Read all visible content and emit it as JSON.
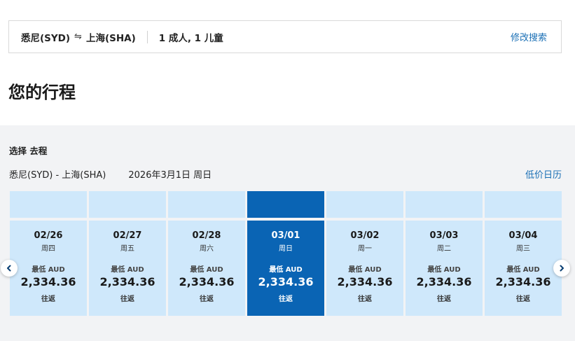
{
  "search": {
    "origin": "悉尼(SYD)",
    "destination": "上海(SHA)",
    "passengers": "1 成人, 1 儿童",
    "modify_label": "修改搜索"
  },
  "page_title": "您的行程",
  "outbound": {
    "section_label": "选择 去程",
    "route": "悉尼(SYD) - 上海(SHA)",
    "date": "2026年3月1日 周日",
    "low_calendar_label": "低价日历"
  },
  "dates": [
    {
      "date": "02/26",
      "weekday": "周四",
      "low_label": "最低 AUD",
      "price": "2,334.36",
      "trip": "往返",
      "selected": false
    },
    {
      "date": "02/27",
      "weekday": "周五",
      "low_label": "最低 AUD",
      "price": "2,334.36",
      "trip": "往返",
      "selected": false
    },
    {
      "date": "02/28",
      "weekday": "周六",
      "low_label": "最低 AUD",
      "price": "2,334.36",
      "trip": "往返",
      "selected": false
    },
    {
      "date": "03/01",
      "weekday": "周日",
      "low_label": "最低 AUD",
      "price": "2,334.36",
      "trip": "往返",
      "selected": true
    },
    {
      "date": "03/02",
      "weekday": "周一",
      "low_label": "最低 AUD",
      "price": "2,334.36",
      "trip": "往返",
      "selected": false
    },
    {
      "date": "03/03",
      "weekday": "周二",
      "low_label": "最低 AUD",
      "price": "2,334.36",
      "trip": "往返",
      "selected": false
    },
    {
      "date": "03/04",
      "weekday": "周三",
      "low_label": "最低 AUD",
      "price": "2,334.36",
      "trip": "往返",
      "selected": false
    }
  ],
  "colors": {
    "selected": "#0a64b4",
    "date_card": "#cfe8fb",
    "link": "#1a6fb5",
    "section_bg": "#f2f3f5"
  },
  "icons": {
    "swap": "swap-arrows-icon",
    "prev": "chevron-left-icon",
    "next": "chevron-right-icon"
  }
}
